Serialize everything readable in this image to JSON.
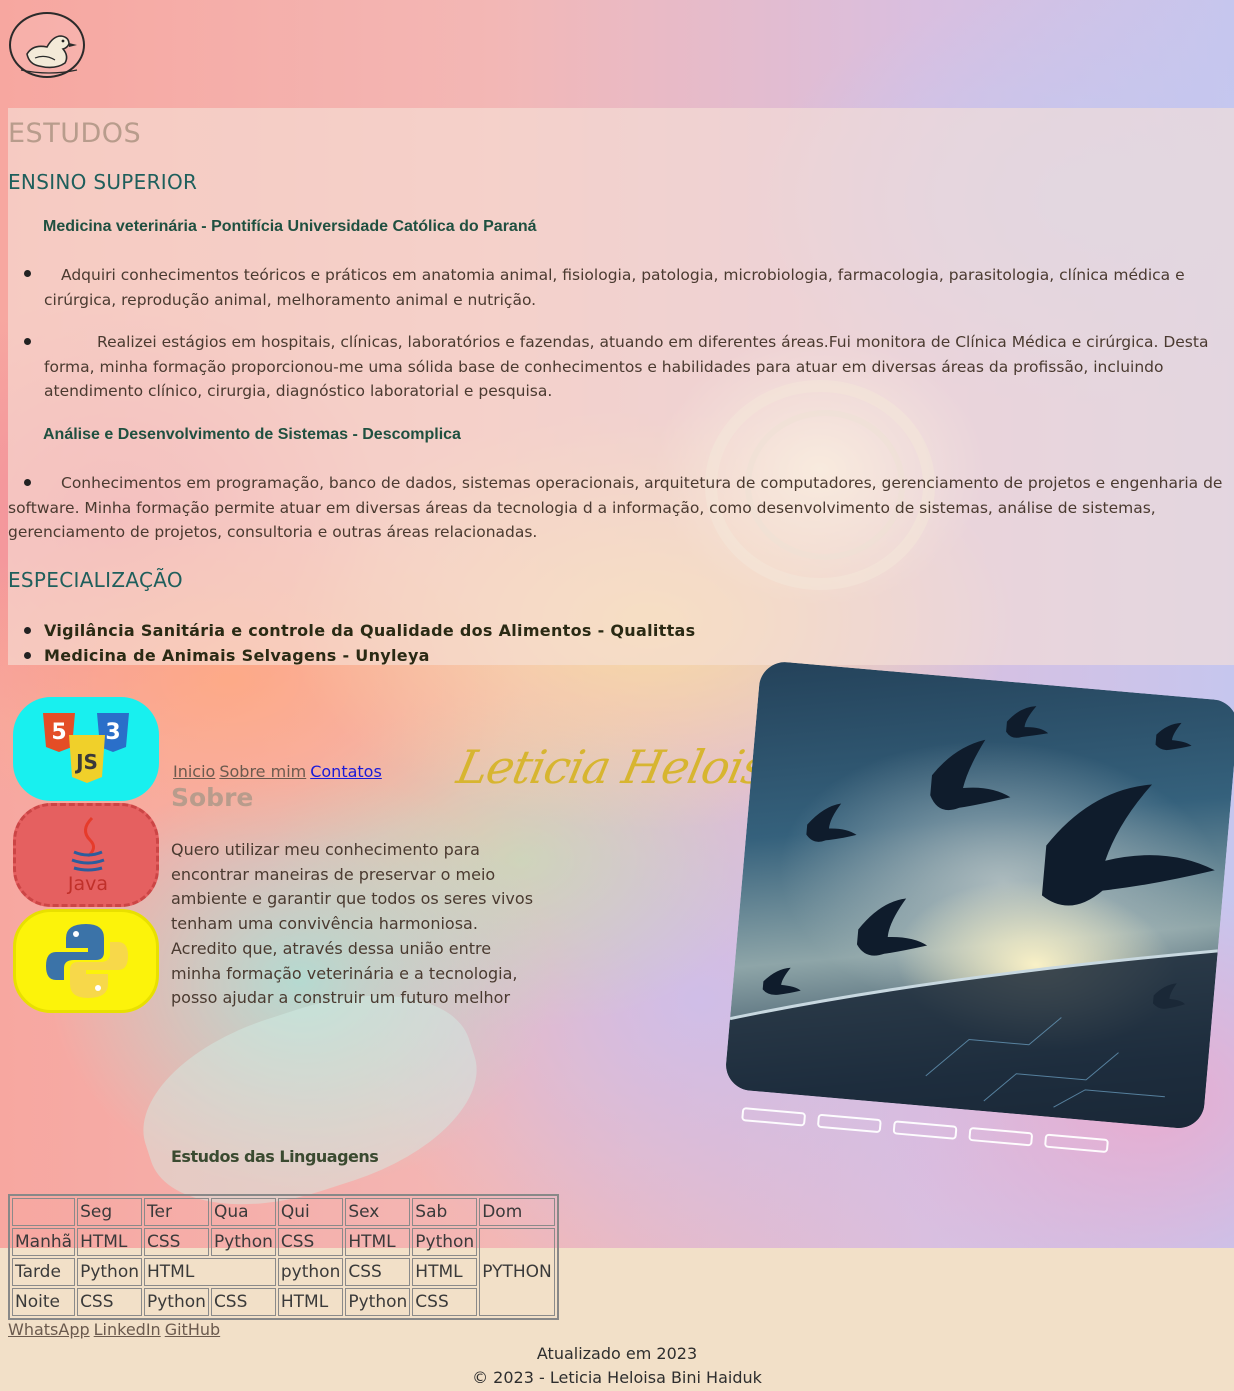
{
  "studies": {
    "title": "ESTUDOS",
    "higher_ed": {
      "heading": "ENSINO SUPERIOR",
      "courses": [
        {
          "name": "Medicina veterinária - Pontifícia Universidade Católica do Paraná",
          "items": [
            "Adquiri conhecimentos teóricos e práticos em anatomia animal, fisiologia, patologia, microbiologia, farmacologia, parasitologia, clínica médica e cirúrgica, reprodução animal, melhoramento animal e nutrição.",
            "Realizei estágios em hospitais, clínicas, laboratórios e fazendas, atuando em diferentes áreas.Fui monitora de Clínica Médica e cirúrgica. Desta forma, minha formação proporcionou-me uma sólida base de conhecimentos e habilidades para atuar em diversas áreas da profissão, incluindo atendimento clínico, cirurgia, diagnóstico laboratorial e pesquisa."
          ]
        },
        {
          "name": "Análise e Desenvolvimento de Sistemas - Descomplica",
          "items": [
            "Conhecimentos em programação, banco de dados, sistemas operacionais, arquitetura de computadores, gerenciamento de projetos e engenharia de software. Minha formação permite atuar em diversas áreas da tecnologia d a informação, como desenvolvimento de sistemas, análise de sistemas, gerenciamento de projetos, consultoria e outras áreas relacionadas."
          ]
        }
      ]
    },
    "specialization": {
      "heading": "ESPECIALIZAÇÃO",
      "items": [
        "Vigilância Sanitária e controle da Qualidade dos Alimentos - Qualittas",
        "Medicina de Animais Selvagens - Unyleya"
      ]
    }
  },
  "nav": {
    "home": "Inicio",
    "about": "Sobre mim",
    "contacts": "Contatos"
  },
  "about": {
    "title": "Sobre",
    "signature": "Leticia Heloisa Bini",
    "text": "Quero utilizar meu conhecimento para encontrar maneiras de preservar o meio ambiente e garantir que todos os seres vivos tenham uma convivência harmoniosa. Acredito que, através dessa união entre minha formação veterinária e a tecnologia, posso ajudar a construir um futuro melhor"
  },
  "languages": {
    "java_label": "Java",
    "js_label": "JS"
  },
  "schedule": {
    "caption": "Estudos das Linguagens",
    "days": [
      "Seg",
      "Ter",
      "Qua",
      "Qui",
      "Sex",
      "Sab",
      "Dom"
    ],
    "rows": [
      {
        "period": "Manhã",
        "cells": [
          "HTML",
          "CSS",
          "Python",
          "CSS",
          "HTML",
          "Python"
        ]
      },
      {
        "period": "Tarde",
        "cells": [
          "Python",
          "HTML",
          "python",
          "CSS",
          "HTML"
        ]
      },
      {
        "period": "Noite",
        "cells": [
          "CSS",
          "Python",
          "CSS",
          "HTML",
          "Python",
          "CSS"
        ]
      }
    ],
    "sunday": "PYTHON"
  },
  "footer": {
    "social": [
      "WhatsApp",
      "LinkedIn",
      "GitHub"
    ],
    "updated": "Atualizado em 2023",
    "copyright": "© 2023 - Leticia Heloisa Bini Haiduk"
  }
}
